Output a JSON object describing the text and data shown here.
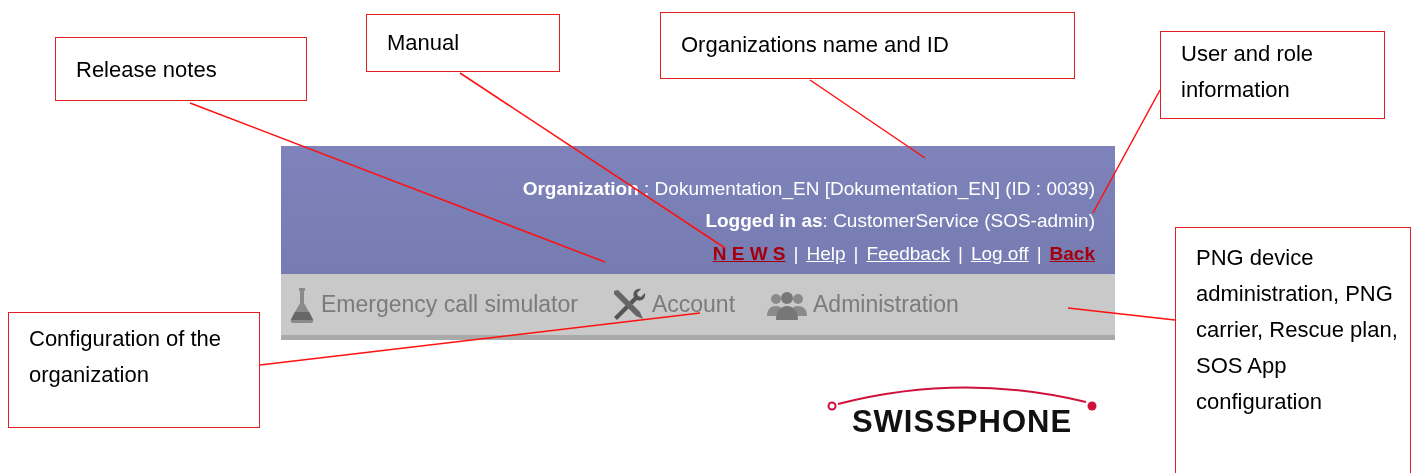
{
  "callouts": [
    {
      "text": "Release notes"
    },
    {
      "text": "Manual"
    },
    {
      "text": "Organizations name and ID"
    },
    {
      "text": "User and role information"
    },
    {
      "text": "Configuration of the organization"
    },
    {
      "text": "PNG device administration, PNG carrier, Rescue plan, SOS App configuration"
    }
  ],
  "header": {
    "organization": {
      "label": "Organization",
      "value": " : Dokumentation_EN [Dokumentation_EN] (ID : 0039)"
    },
    "logged_in": {
      "label": "Logged in as",
      "value": ": CustomerService (SOS-admin)"
    },
    "links": [
      {
        "text": "N E W S",
        "kind": "alert"
      },
      {
        "text": "|",
        "kind": "separator"
      },
      {
        "text": "Help",
        "kind": "link"
      },
      {
        "text": "|",
        "kind": "separator"
      },
      {
        "text": "Feedback",
        "kind": "link"
      },
      {
        "text": "|",
        "kind": "separator"
      },
      {
        "text": "Log off",
        "kind": "link"
      },
      {
        "text": "|",
        "kind": "separator"
      },
      {
        "text": "Back",
        "kind": "alert"
      }
    ]
  },
  "nav": [
    {
      "label": "Emergency call simulator"
    },
    {
      "label": "Account"
    },
    {
      "label": "Administration"
    }
  ],
  "logo": {
    "text": "SWISSPHONE"
  }
}
